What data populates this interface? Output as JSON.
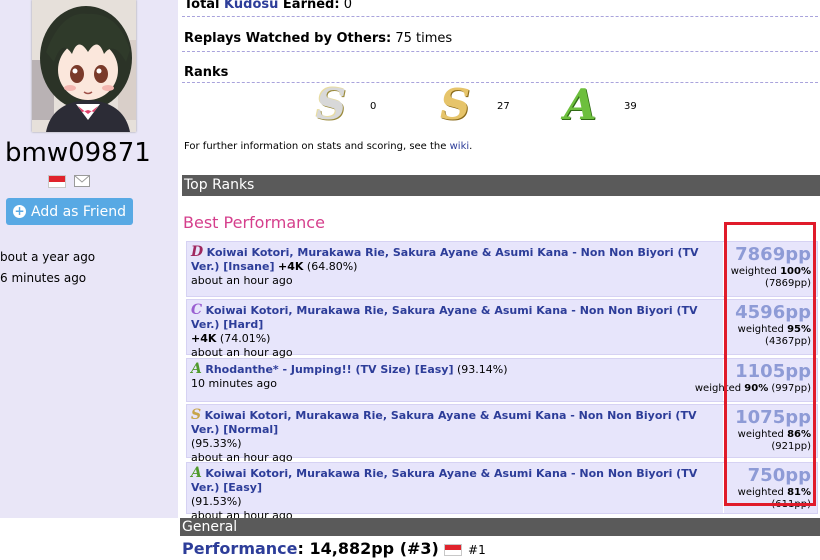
{
  "profile": {
    "username": "bmw09871",
    "add_friend_label": "Add as Friend",
    "line1": "bout a year ago",
    "line2": "6 minutes ago"
  },
  "stats": {
    "kudosu_prefix": "Total ",
    "kudosu_word": "Kudosu",
    "kudosu_suffix": " Earned:",
    "kudosu_value": "0",
    "replays_label": "Replays Watched by Others:",
    "replays_value": "75 times",
    "ranks_label": "Ranks"
  },
  "ranks": [
    {
      "grade": "S",
      "count": "0",
      "color": "#c9a633",
      "silver": true
    },
    {
      "grade": "S",
      "count": "27",
      "color": "#c9a633"
    },
    {
      "grade": "A",
      "count": "39",
      "color": "#3f9a2a"
    }
  ],
  "info": {
    "text": "For further information on stats and scoring, see the ",
    "link": "wiki",
    "end": "."
  },
  "sections": {
    "top_ranks": "Top Ranks",
    "best_performance": "Best Performance",
    "general": "General"
  },
  "scores": [
    {
      "grade": "D",
      "title": "Koiwai Kotori, Murakawa Rie, Sakura Ayane & Asumi Kana - Non Non Biyori (TV Ver.) [Insane]",
      "mods": "+4K",
      "accuracy": "(64.80%)",
      "time": "about an hour ago",
      "pp": "7869pp",
      "weighted": "100%",
      "weighted_pp": "(7869pp)"
    },
    {
      "grade": "C",
      "title": "Koiwai Kotori, Murakawa Rie, Sakura Ayane & Asumi Kana - Non Non Biyori (TV Ver.) [Hard]",
      "mods": "+4K",
      "accuracy": "(74.01%)",
      "time": "about an hour ago",
      "pp": "4596pp",
      "weighted": "95%",
      "weighted_pp": "(4367pp)"
    },
    {
      "grade": "A",
      "title": "Rhodanthe* - Jumping!! (TV Size) [Easy]",
      "mods": "",
      "accuracy": "(93.14%)",
      "time": "10 minutes ago",
      "pp": "1105pp",
      "weighted": "90%",
      "weighted_pp": "(997pp)"
    },
    {
      "grade": "S",
      "title": "Koiwai Kotori, Murakawa Rie, Sakura Ayane & Asumi Kana - Non Non Biyori (TV Ver.) [Normal]",
      "mods": "",
      "accuracy": "(95.33%)",
      "time": "about an hour ago",
      "pp": "1075pp",
      "weighted": "86%",
      "weighted_pp": "(921pp)"
    },
    {
      "grade": "A",
      "title": "Koiwai Kotori, Murakawa Rie, Sakura Ayane & Asumi Kana - Non Non Biyori (TV Ver.) [Easy]",
      "mods": "",
      "accuracy": "(91.53%)",
      "time": "about an hour ago",
      "pp": "750pp",
      "weighted": "81%",
      "weighted_pp": "(611pp)"
    }
  ],
  "weighted_label": "weighted ",
  "performance": {
    "label": "Performance",
    "value": ": 14,882pp (#3)",
    "country_rank": "#1"
  },
  "colors": {
    "sidebar_bg": "#e9e6f7",
    "link": "#2d3d99",
    "highlight": "#e01b2a",
    "best_title": "#d53f8c"
  }
}
